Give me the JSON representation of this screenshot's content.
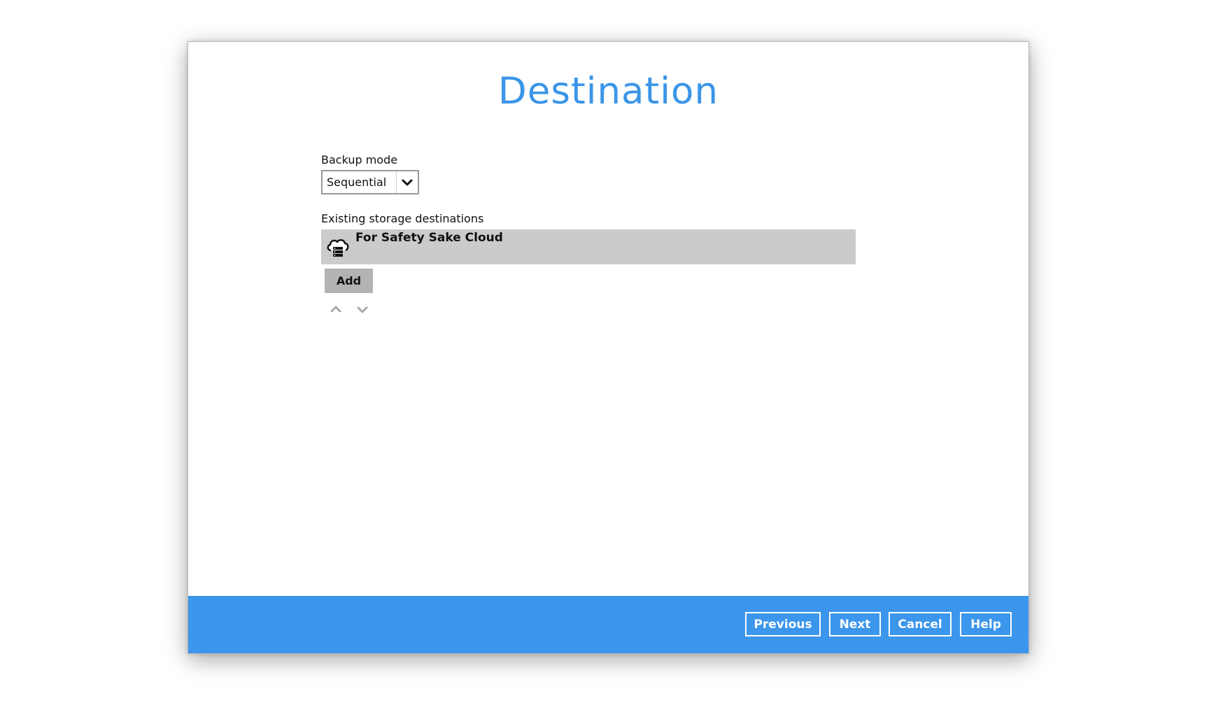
{
  "dialog": {
    "title": "Destination"
  },
  "backup_mode": {
    "label": "Backup mode",
    "selected": "Sequential",
    "icon": "chevron-down-icon"
  },
  "storage": {
    "label": "Existing storage destinations",
    "destinations": [
      {
        "name": "For Safety Sake Cloud",
        "icon": "cloud-server-icon"
      }
    ],
    "add_label": "Add",
    "move_up_icon": "chevron-up-icon",
    "move_down_icon": "chevron-down-icon"
  },
  "footer": {
    "buttons": {
      "previous": "Previous",
      "next": "Next",
      "cancel": "Cancel",
      "help": "Help"
    }
  },
  "colors": {
    "accent": "#3b96ec",
    "title": "#3a95e8",
    "selected_row": "#cbcbcb",
    "add_button": "#b3b3b3"
  }
}
